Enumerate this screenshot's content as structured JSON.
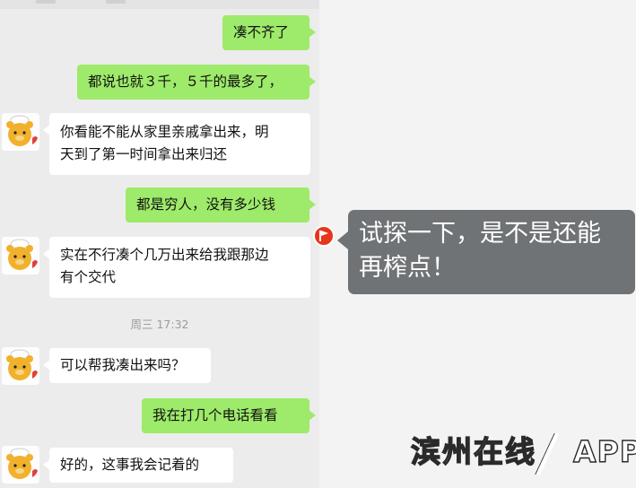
{
  "conversation": {
    "messages": [
      {
        "side": "right",
        "text": "凑不齐了"
      },
      {
        "side": "right",
        "text": "都说也就３千，５千的最多了，"
      },
      {
        "side": "left",
        "lines": [
          "你看能不能从家里亲戚拿出来，明",
          "天到了第一时间拿出来归还"
        ]
      },
      {
        "side": "right",
        "text": "都是穷人，没有多少钱"
      },
      {
        "side": "left",
        "lines": [
          "实在不行凑个几万出来给我跟那边",
          "有个交代"
        ]
      },
      {
        "side": "left",
        "text": "可以帮我凑出来吗？"
      },
      {
        "side": "right",
        "text": "我在打几个电话看看"
      },
      {
        "side": "left",
        "text": "好的，这事我会记着的"
      }
    ],
    "timestamp": "周三 17:32"
  },
  "annotation": {
    "lines": [
      "试探一下，是不是还能",
      "再榨点！"
    ]
  },
  "watermark": {
    "name": "滨州在线",
    "app": "APP"
  },
  "colors": {
    "sent_bubble": "#9eea6a",
    "received_bubble": "#ffffff",
    "annotation_bg": "#6f7376",
    "flag": "#e8361d"
  }
}
